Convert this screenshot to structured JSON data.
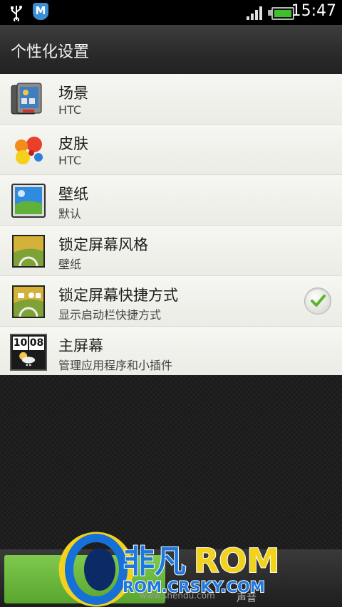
{
  "status_bar": {
    "time": "15:47",
    "icons": [
      "usb-icon",
      "m-app-icon",
      "signal-icon",
      "battery-icon"
    ],
    "app_badge": "M"
  },
  "title": "个性化设置",
  "items": [
    {
      "title": "场景",
      "subtitle": "HTC",
      "icon": "scene-icon"
    },
    {
      "title": "皮肤",
      "subtitle": "HTC",
      "icon": "skin-icon"
    },
    {
      "title": "壁纸",
      "subtitle": "默认",
      "icon": "wallpaper-icon"
    },
    {
      "title": "锁定屏幕风格",
      "subtitle": "壁纸",
      "icon": "lockscreen-style-icon"
    },
    {
      "title": "锁定屏幕快捷方式",
      "subtitle": "显示启动栏快捷方式",
      "icon": "lockscreen-shortcut-icon",
      "checked": true
    },
    {
      "title": "主屏幕",
      "subtitle": "管理应用程序和小插件",
      "icon": "home-screen-icon"
    }
  ],
  "home_clock": {
    "hours": "10",
    "minutes": "08"
  },
  "bottom": {
    "hint": "www.shendu.com",
    "button2_label": "声音"
  },
  "watermark": {
    "brand_cn": "非凡",
    "brand_en": "ROM",
    "url": "ROM.CRSKY.COM"
  },
  "colors": {
    "accent_green": "#6dbb3e",
    "battery_green": "#3ec02a",
    "list_bg": "#f1f1ec",
    "logo_blue": "#1670d8",
    "logo_yellow": "#f2d21c"
  }
}
